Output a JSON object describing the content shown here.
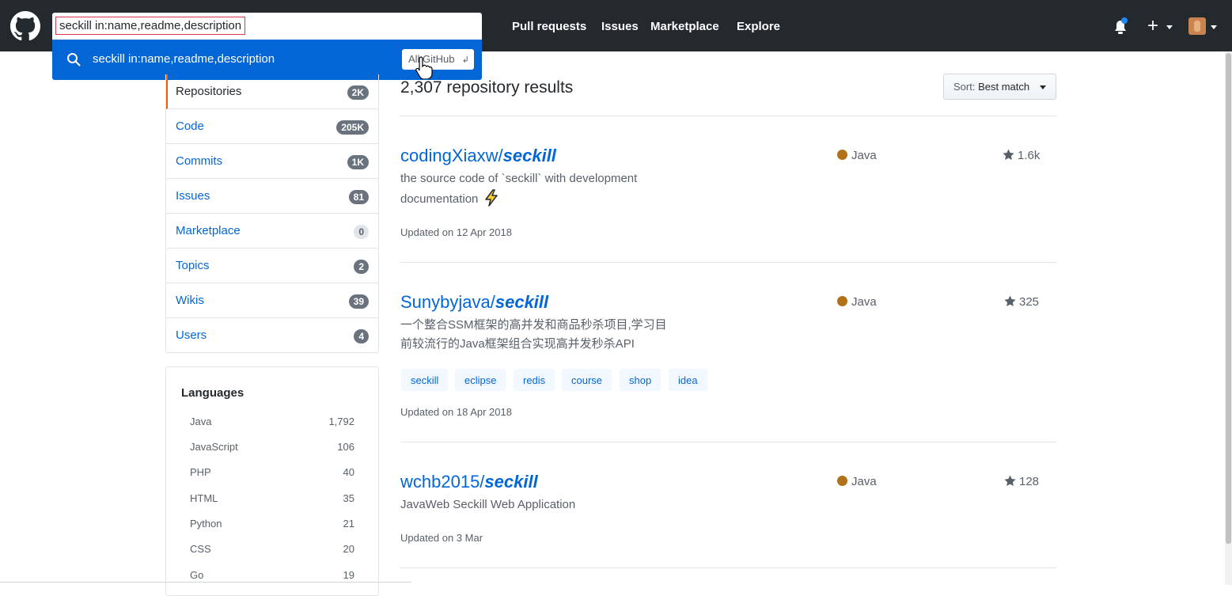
{
  "header": {
    "search_value": "seckill in:name,readme,description",
    "nav": [
      "Pull requests",
      "Issues",
      "Marketplace",
      "Explore"
    ],
    "plus_label": "+"
  },
  "search_dropdown": {
    "suggestion": "seckill in:name,readme,description",
    "scope_badge": "All GitHub",
    "enter_glyph": "↲"
  },
  "filters": [
    {
      "label": "Repositories",
      "count": "2K",
      "selected": true
    },
    {
      "label": "Code",
      "count": "205K"
    },
    {
      "label": "Commits",
      "count": "1K"
    },
    {
      "label": "Issues",
      "count": "81"
    },
    {
      "label": "Marketplace",
      "count": "0"
    },
    {
      "label": "Topics",
      "count": "2"
    },
    {
      "label": "Wikis",
      "count": "39"
    },
    {
      "label": "Users",
      "count": "4"
    }
  ],
  "languages": {
    "title": "Languages",
    "items": [
      {
        "name": "Java",
        "count": "1,792"
      },
      {
        "name": "JavaScript",
        "count": "106"
      },
      {
        "name": "PHP",
        "count": "40"
      },
      {
        "name": "HTML",
        "count": "35"
      },
      {
        "name": "Python",
        "count": "21"
      },
      {
        "name": "CSS",
        "count": "20"
      },
      {
        "name": "Go",
        "count": "19"
      }
    ]
  },
  "results": {
    "title": "2,307 repository results",
    "sort_prefix": "Sort:",
    "sort_value": "Best match"
  },
  "repos": [
    {
      "owner": "codingXiaxw/",
      "name": "seckill",
      "desc_line1": "the source code of `seckill` with development",
      "desc_line2": "documentation",
      "language": "Java",
      "stars": "1.6k",
      "updated": "Updated on 12 Apr 2018"
    },
    {
      "owner": "Sunybyjava/",
      "name": "seckill",
      "desc_line1": "一个整合SSM框架的高并发和商品秒杀项目,学习目",
      "desc_line2": "前较流行的Java框架组合实现高并发秒杀API",
      "language": "Java",
      "stars": "325",
      "topics": [
        "seckill",
        "eclipse",
        "redis",
        "course",
        "shop",
        "idea"
      ],
      "updated": "Updated on 18 Apr 2018"
    },
    {
      "owner": "wchb2015/",
      "name": "seckill",
      "desc_line1": "JavaWeb Seckill Web Application",
      "language": "Java",
      "stars": "128",
      "updated": "Updated on 3 Mar"
    }
  ],
  "colors": {
    "header_bg": "#24292e",
    "link": "#0366d6",
    "java": "#b07219",
    "selected_accent": "#e36209"
  }
}
